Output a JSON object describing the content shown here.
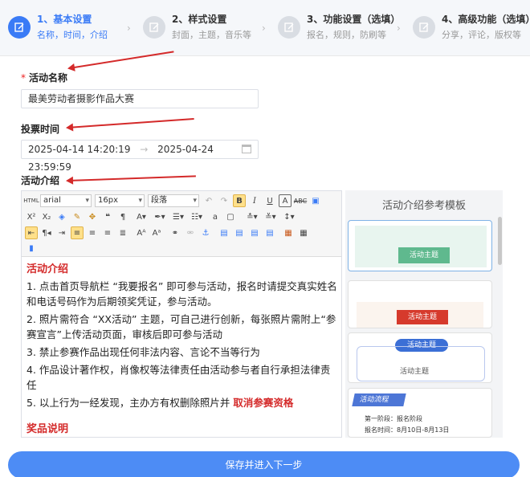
{
  "steps": [
    {
      "title": "1、基本设置",
      "sub": "名称，时间，介绍",
      "active": true
    },
    {
      "title": "2、样式设置",
      "sub": "封面，主题，音乐等",
      "active": false
    },
    {
      "title": "3、功能设置（选填）",
      "sub": "报名，规则，防刷等",
      "active": false
    },
    {
      "title": "4、高级功能（选填）",
      "sub": "分享，评论，版权等",
      "active": false
    }
  ],
  "form": {
    "name_label": "活动名称",
    "name_required": "*",
    "name_value": "最美劳动者摄影作品大赛",
    "time_label": "投票时间",
    "time_start": "2025-04-14 14:20:19",
    "time_sep": "→",
    "time_end": "2025-04-24 23:59:59",
    "intro_label": "活动介绍"
  },
  "editor": {
    "font": "arial",
    "size": "16px",
    "para": "段落",
    "heading": "活动介绍",
    "items": [
      "1. 点击首页导航栏 “我要报名” 即可参与活动，报名时请提交真实姓名和电话号码作为后期领奖凭证，参与活动。",
      "2. 照片需符合 “XX活动” 主题，可自己进行创新，每张照片需附上“参赛宣言”上传活动页面，审核后即可参与活动",
      "3. 禁止参赛作品出现任何非法内容、言论不当等行为",
      "4. 作品设计著作权，肖像权等法律责任由活动参与者自行承担法律责任",
      "5. 以上行为一经发现，主办方有权删除照片并 "
    ],
    "item5_highlight": "取消参赛资格",
    "next_heading": "奖品说明"
  },
  "templates": {
    "title": "活动介绍参考模板",
    "t1_label": "活动主题",
    "t2_label": "活动主题",
    "t3_badge": "活动主题",
    "t3_label": "活动主题",
    "t4_tag": "活动流程",
    "t4_line1": "第一阶段：报名阶段",
    "t4_line2": "报名时间：8月10日-8月13日"
  },
  "footer": {
    "save_label": "保存并进入下一步"
  },
  "colors": {
    "accent": "#3a7bf6",
    "warn": "#d42a2a"
  }
}
